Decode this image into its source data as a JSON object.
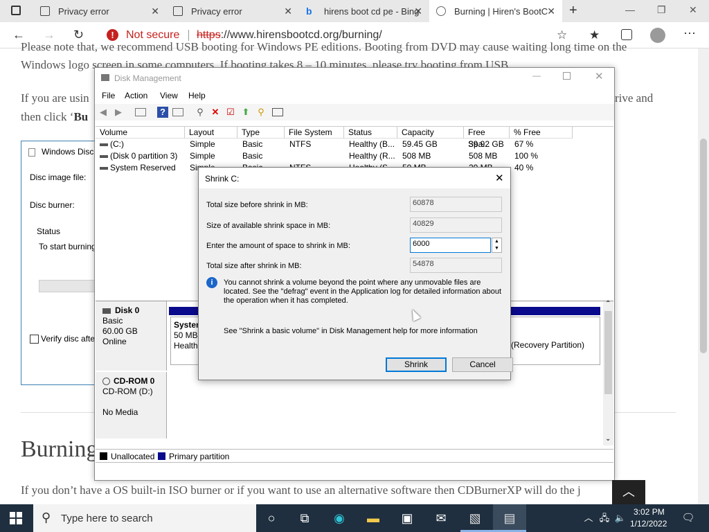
{
  "browser": {
    "tabs": [
      {
        "title": "Privacy error",
        "icon": "warning-page-icon"
      },
      {
        "title": "Privacy error",
        "icon": "warning-page-icon"
      },
      {
        "title": "hirens boot cd pe - Bing",
        "icon": "bing-icon"
      },
      {
        "title": "Burning | Hiren's BootC",
        "icon": "globe-icon",
        "active": true
      }
    ],
    "security_label": "Not secure",
    "url_scheme": "https",
    "url_rest": "://www.hirensbootcd.org/burning/"
  },
  "page": {
    "line1": "Please note that, we recommend USB booting for Windows PE editions. Booting from DVD may cause waiting long time on the",
    "line2": "Windows logo screen in some computers. If booting takes 8 – 10 minutes, please try booting from USB.",
    "line3_start": "If you are usin",
    "line3_end": "rive and",
    "line4_start": "then click ‘",
    "line4_bold": "Bu",
    "heading": "Burning",
    "bottom_line": "If you don’t have a OS built-in ISO burner or if you want to use an alternative software then CDBurnerXP will do the j",
    "burn_dialog": {
      "title": "Windows Disc",
      "image_label": "Disc image file:",
      "burner_label": "Disc burner:",
      "status_label": "Status",
      "status_text": "To start burning",
      "verify_label": "Verify disc afte"
    }
  },
  "disk_management": {
    "title": "Disk Management",
    "menu": [
      "File",
      "Action",
      "View",
      "Help"
    ],
    "columns": [
      "Volume",
      "Layout",
      "Type",
      "File System",
      "Status",
      "Capacity",
      "Free Spa...",
      "% Free"
    ],
    "rows": [
      [
        "(C:)",
        "Simple",
        "Basic",
        "NTFS",
        "Healthy (B...",
        "59.45 GB",
        "39.92 GB",
        "67 %"
      ],
      [
        "(Disk 0 partition 3)",
        "Simple",
        "Basic",
        "",
        "Healthy (R...",
        "508 MB",
        "508 MB",
        "100 %"
      ],
      [
        "System Reserved",
        "Simple",
        "Basic",
        "NTFS",
        "Healthy (S...",
        "50 MB",
        "20 MB",
        "40 %"
      ]
    ],
    "disk0": {
      "name": "Disk 0",
      "type": "Basic",
      "size": "60.00 GB",
      "state": "Online"
    },
    "disk0_partition": {
      "name": "System",
      "size": "50 MB",
      "status": "Healthy"
    },
    "recovery_label": "(Recovery Partition)",
    "cdrom": {
      "name": "CD-ROM 0",
      "type": "CD-ROM (D:)",
      "media": "No Media"
    },
    "legend": [
      "Unallocated",
      "Primary partition"
    ]
  },
  "shrink_dialog": {
    "title": "Shrink C:",
    "total_before_label": "Total size before shrink in MB:",
    "total_before": "60878",
    "available_label": "Size of available shrink space in MB:",
    "available": "40829",
    "amount_label": "Enter the amount of space to shrink in MB:",
    "amount": "6000",
    "total_after_label": "Total size after shrink in MB:",
    "total_after": "54878",
    "info": "You cannot shrink a volume beyond the point where any unmovable files are located. See the \"defrag\" event in the Application log for detailed information about the operation when it has completed.",
    "help": "See \"Shrink a basic volume\" in Disk Management help for more information",
    "shrink_button": "Shrink",
    "cancel_button": "Cancel"
  },
  "taskbar": {
    "search_placeholder": "Type here to search",
    "time": "3:02 PM",
    "date": "1/12/2022"
  },
  "colors": {
    "primary_partition": "#0a0a8c",
    "taskbar": "#1f2f3f",
    "not_secure": "#c5221f",
    "focus_blue": "#0078d7"
  }
}
